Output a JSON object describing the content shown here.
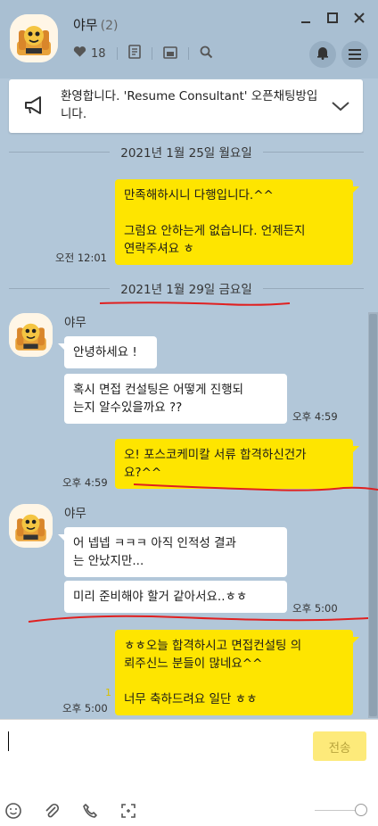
{
  "header": {
    "title": "야무",
    "member_count": "(2)",
    "likes": "18"
  },
  "notice": {
    "text": "환영합니다. 'Resume Consultant' 오픈채팅방입니다."
  },
  "dates": {
    "first": "2021년 1월 25일 월요일",
    "second": "2021년 1월 29일 금요일"
  },
  "messages": {
    "m1_text": "만족해하시니 다행입니다.^^\n\n그럼요 안하는게 없습니다. 언제든지\n연락주셔요 ㅎ",
    "m1_time": "오전 12:01",
    "sender1": "야무",
    "m2_text": "안녕하세요 !",
    "m3_text": "혹시 면접 컨설팅은 어떻게 진행되\n는지 알수있을까요 ??",
    "m3_time": "오후 4:59",
    "m4_text": "오! 포스코케미칼 서류 합격하신건가\n요?^^",
    "m4_time": "오후 4:59",
    "sender2": "야무",
    "m5_text": "어 넵넵 ㅋㅋㅋ 아직 인적성 결과\n는 안났지만...",
    "m6_text": "미리 준비해야 할거 같아서요..ㅎㅎ",
    "m6_time": "오후 5:00",
    "m7_text": "ㅎㅎ오늘 합격하시고 면접컨설팅 의\n뢰주신느 분들이 많네요^^\n\n너무 축하드려요 일단 ㅎㅎ",
    "m7_unread": "1",
    "m7_time": "오후 5:00"
  },
  "input": {
    "send_label": "전송"
  },
  "icons": {
    "heart": "heart-icon",
    "notes": "notes-icon",
    "album": "album-icon",
    "search": "search-icon",
    "bell": "bell-icon",
    "menu": "menu-icon",
    "megaphone": "megaphone-icon",
    "emoji": "emoji-icon",
    "attach": "attach-icon",
    "call": "call-icon",
    "capture": "capture-icon"
  },
  "colors": {
    "background": "#b2c7d9",
    "my_bubble": "#fee500",
    "other_bubble": "#ffffff",
    "annotation_red": "#e02020"
  }
}
